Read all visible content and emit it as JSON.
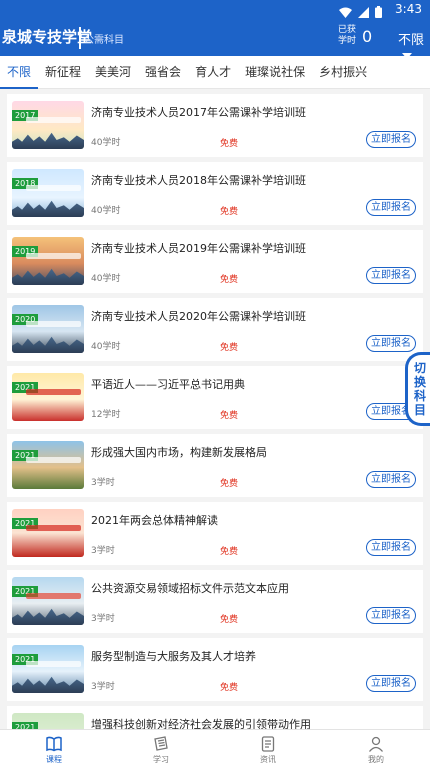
{
  "status_bar": {
    "time": "3:43"
  },
  "header": {
    "title": "泉城专技学堂",
    "subtitle": "公需科目",
    "earned_label": "已获学时",
    "earned_value": "0",
    "filter": "不限"
  },
  "tabs": [
    {
      "label": "不限",
      "active": true
    },
    {
      "label": "新征程"
    },
    {
      "label": "美美河"
    },
    {
      "label": "强省会"
    },
    {
      "label": "育人才"
    },
    {
      "label": "璀璨说社保"
    },
    {
      "label": "乡村振兴"
    }
  ],
  "courses": [
    {
      "year": "2017",
      "title": "济南专业技术人员2017年公需课补学培训班",
      "hours": "40学时",
      "fee": "免费",
      "action": "立即报名"
    },
    {
      "year": "2018",
      "title": "济南专业技术人员2018年公需课补学培训班",
      "hours": "40学时",
      "fee": "免费",
      "action": "立即报名"
    },
    {
      "year": "2019",
      "title": "济南专业技术人员2019年公需课补学培训班",
      "hours": "40学时",
      "fee": "免费",
      "action": "立即报名"
    },
    {
      "year": "2020",
      "title": "济南专业技术人员2020年公需课补学培训班",
      "hours": "40学时",
      "fee": "免费",
      "action": "立即报名"
    },
    {
      "year": "2021",
      "title": "平语近人——习近平总书记用典",
      "hours": "12学时",
      "fee": "免费",
      "action": "立即报名"
    },
    {
      "year": "2021",
      "title": "形成强大国内市场，构建新发展格局",
      "hours": "3学时",
      "fee": "免费",
      "action": "立即报名"
    },
    {
      "year": "2021",
      "title": "2021年两会总体精神解读",
      "hours": "3学时",
      "fee": "免费",
      "action": "立即报名"
    },
    {
      "year": "2021",
      "title": "公共资源交易领域招标文件示范文本应用",
      "hours": "3学时",
      "fee": "免费",
      "action": "立即报名"
    },
    {
      "year": "2021",
      "title": "服务型制造与大服务及其人才培养",
      "hours": "3学时",
      "fee": "免费",
      "action": "立即报名"
    },
    {
      "year": "2021",
      "title": "增强科技创新对经济社会发展的引领带动作用",
      "hours": "",
      "fee": "",
      "action": ""
    }
  ],
  "side_button": "切换科目",
  "bottom_nav": [
    {
      "label": "课程",
      "icon": "book-icon",
      "active": true
    },
    {
      "label": "学习",
      "icon": "study-icon"
    },
    {
      "label": "资讯",
      "icon": "news-icon"
    },
    {
      "label": "我的",
      "icon": "user-icon"
    }
  ],
  "colors": {
    "primary": "#1d63c8",
    "fee": "#e0301e",
    "year_badge": "#1e9d3c"
  }
}
